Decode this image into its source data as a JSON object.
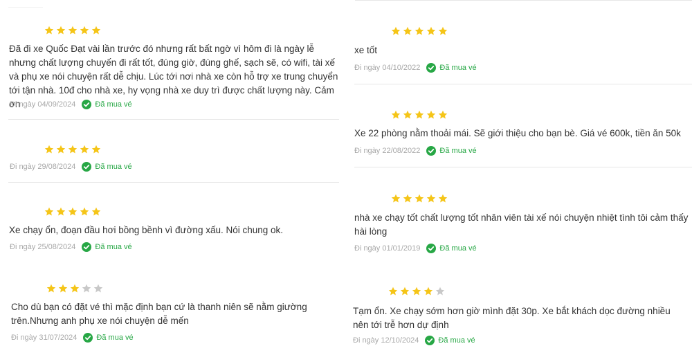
{
  "colors": {
    "star_filled": "#f5c518",
    "star_empty": "#c8c8c8",
    "verified": "#27a745",
    "date": "#a8a8a8"
  },
  "icons": {
    "star": "star-icon",
    "verified": "check-circle-icon"
  },
  "left_reviews": [
    {
      "rating": 5,
      "text": "Đã đi xe Quốc Đạt vài lần trước đó nhưng rất bất ngờ vì hôm đi là ngày lễ nhưng chất lượng chuyến đi rất tốt, đúng giờ, đúng ghế, sạch sẽ, có wifi, tài xế và phụ xe nói chuyện rất dễ chịu. Lúc tới nơi nhà xe còn hỗ trợ xe trung chuyển tới tận nhà. 10đ cho nhà xe, hy vọng nhà xe duy trì được chất lượng này. Cảm ơn",
      "date": "Đi ngày 04/09/2024",
      "badge": "Đã mua vé"
    },
    {
      "rating": 5,
      "text": "",
      "date": "Đi ngày 29/08/2024",
      "badge": "Đã mua vé"
    },
    {
      "rating": 5,
      "text": "Xe chạy ổn, đoạn đầu hơi bồng bềnh vì đường xấu. Nói chung ok.",
      "date": "Đi ngày 25/08/2024",
      "badge": "Đã mua vé"
    },
    {
      "rating": 3,
      "text": "Cho dù bạn có đặt vé thì mặc định bạn cứ là thanh niên sẽ nằm giường trên.Nhưng anh phụ xe nói chuyện dễ mến",
      "date": "Đi ngày 31/07/2024",
      "badge": "Đã mua vé"
    }
  ],
  "right_reviews": [
    {
      "rating": 5,
      "text": "xe tốt",
      "date": "Đi ngày 04/10/2022",
      "badge": "Đã mua vé"
    },
    {
      "rating": 5,
      "text": "Xe 22 phòng nằm thoải mái. Sẽ giới thiệu cho bạn bè. Giá vé 600k, tiền ăn 50k",
      "date": "Đi ngày 22/08/2022",
      "badge": "Đã mua vé"
    },
    {
      "rating": 5,
      "text": "nhà xe chạy tốt chất lượng tốt nhân viên tài xế nói chuyện nhiệt tình tôi cảm thấy hài lòng",
      "date": "Đi ngày 01/01/2019",
      "badge": "Đã mua vé"
    },
    {
      "rating": 4,
      "text": "Tạm ổn. Xe chạy sớm hơn giờ mình đặt 30p. Xe bắt khách dọc đường nhiều nên tới trễ hơn dự định",
      "date": "Đi ngày 12/10/2024",
      "badge": "Đã mua vé"
    }
  ]
}
